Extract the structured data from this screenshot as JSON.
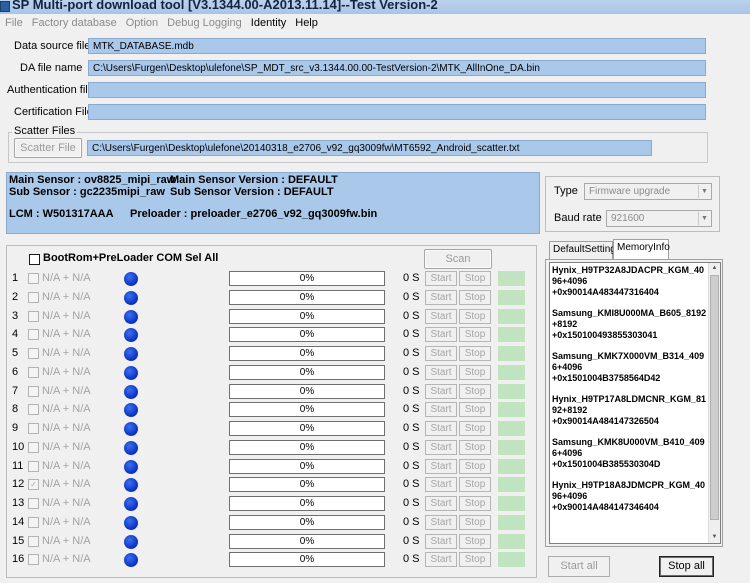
{
  "window": {
    "title": "SP Multi-port download tool [V3.1344.00-A2013.11.14]--Test Version-2"
  },
  "menu": [
    {
      "label": "File",
      "enabled": false
    },
    {
      "label": "Factory database",
      "enabled": false
    },
    {
      "label": "Option",
      "enabled": false
    },
    {
      "label": "Debug Logging",
      "enabled": false
    },
    {
      "label": "Identity",
      "enabled": true
    },
    {
      "label": "Help",
      "enabled": true
    }
  ],
  "files": {
    "data_source_label": "Data source file",
    "data_source_value": "MTK_DATABASE.mdb",
    "da_label": "DA file name",
    "da_value": "C:\\Users\\Furgen\\Desktop\\ulefone\\SP_MDT_src_v3.1344.00.00-TestVersion-2\\MTK_AllInOne_DA.bin",
    "auth_label": "Authentication file",
    "auth_value": "",
    "cert_label": "Certification File",
    "cert_value": ""
  },
  "scatter": {
    "group_title": "Scatter Files",
    "button_label": "Scatter File",
    "value": "C:\\Users\\Furgen\\Desktop\\ulefone\\20140318_e2706_v92_gq3009fw\\MT6592_Android_scatter.txt"
  },
  "sensor": {
    "main_sensor": "Main Sensor : ov8825_mipi_raw",
    "main_sensor_version": "Main Sensor Version : DEFAULT",
    "sub_sensor": "Sub Sensor : gc2235mipi_raw",
    "sub_sensor_version": "Sub Sensor Version : DEFAULT",
    "lcm": "LCM : W501317AAA",
    "preloader": "Preloader : preloader_e2706_v92_gq3009fw.bin"
  },
  "options": {
    "type_label": "Type",
    "type_value": "Firmware upgrade",
    "baud_label": "Baud rate",
    "baud_value": "921600"
  },
  "ports": {
    "select_all_label": "BootRom+PreLoader COM Sel All",
    "scan_label": "Scan",
    "start_label": "Start",
    "stop_label": "Stop",
    "rows": [
      {
        "num": "1",
        "port": "N/A + N/A",
        "progress": "0%",
        "time": "0 S",
        "checked": false
      },
      {
        "num": "2",
        "port": "N/A + N/A",
        "progress": "0%",
        "time": "0 S",
        "checked": false
      },
      {
        "num": "3",
        "port": "N/A + N/A",
        "progress": "0%",
        "time": "0 S",
        "checked": false
      },
      {
        "num": "4",
        "port": "N/A + N/A",
        "progress": "0%",
        "time": "0 S",
        "checked": false
      },
      {
        "num": "5",
        "port": "N/A + N/A",
        "progress": "0%",
        "time": "0 S",
        "checked": false
      },
      {
        "num": "6",
        "port": "N/A + N/A",
        "progress": "0%",
        "time": "0 S",
        "checked": false
      },
      {
        "num": "7",
        "port": "N/A + N/A",
        "progress": "0%",
        "time": "0 S",
        "checked": false
      },
      {
        "num": "8",
        "port": "N/A + N/A",
        "progress": "0%",
        "time": "0 S",
        "checked": false
      },
      {
        "num": "9",
        "port": "N/A + N/A",
        "progress": "0%",
        "time": "0 S",
        "checked": false
      },
      {
        "num": "10",
        "port": "N/A + N/A",
        "progress": "0%",
        "time": "0 S",
        "checked": false
      },
      {
        "num": "11",
        "port": "N/A + N/A",
        "progress": "0%",
        "time": "0 S",
        "checked": false
      },
      {
        "num": "12",
        "port": "N/A + N/A",
        "progress": "0%",
        "time": "0 S",
        "checked": true
      },
      {
        "num": "13",
        "port": "N/A + N/A",
        "progress": "0%",
        "time": "0 S",
        "checked": false
      },
      {
        "num": "14",
        "port": "N/A + N/A",
        "progress": "0%",
        "time": "0 S",
        "checked": false
      },
      {
        "num": "15",
        "port": "N/A + N/A",
        "progress": "0%",
        "time": "0 S",
        "checked": false
      },
      {
        "num": "16",
        "port": "N/A + N/A",
        "progress": "0%",
        "time": "0 S",
        "checked": false
      }
    ]
  },
  "tabs": {
    "default_setting": "DefaultSetting",
    "memory_info": "MemoryInfo",
    "active": "MemoryInfo"
  },
  "memory_info": [
    "Hynix_H9TP32A8JDACPR_KGM_4096+4096\n+0x90014A483447316404",
    "Samsung_KMI8U000MA_B605_8192+8192\n+0x150100493855303041",
    "Samsung_KMK7X000VM_B314_4096+4096\n+0x1501004B3758564D42",
    "Hynix_H9TP17A8LDMCNR_KGM_8192+8192\n+0x90014A484147326504",
    "Samsung_KMK8U000VM_B410_4096+4096\n+0x1501004B385530304D",
    "Hynix_H9TP18A8JDMCPR_KGM_4096+4096\n+0x90014A484147346404"
  ],
  "actions": {
    "start_all": "Start all",
    "stop_all": "Stop all"
  },
  "colors": {
    "field_bg": "#a9c8ea",
    "status_dot": "#0a2fbe",
    "ready_indicator": "#bfe4bf"
  }
}
